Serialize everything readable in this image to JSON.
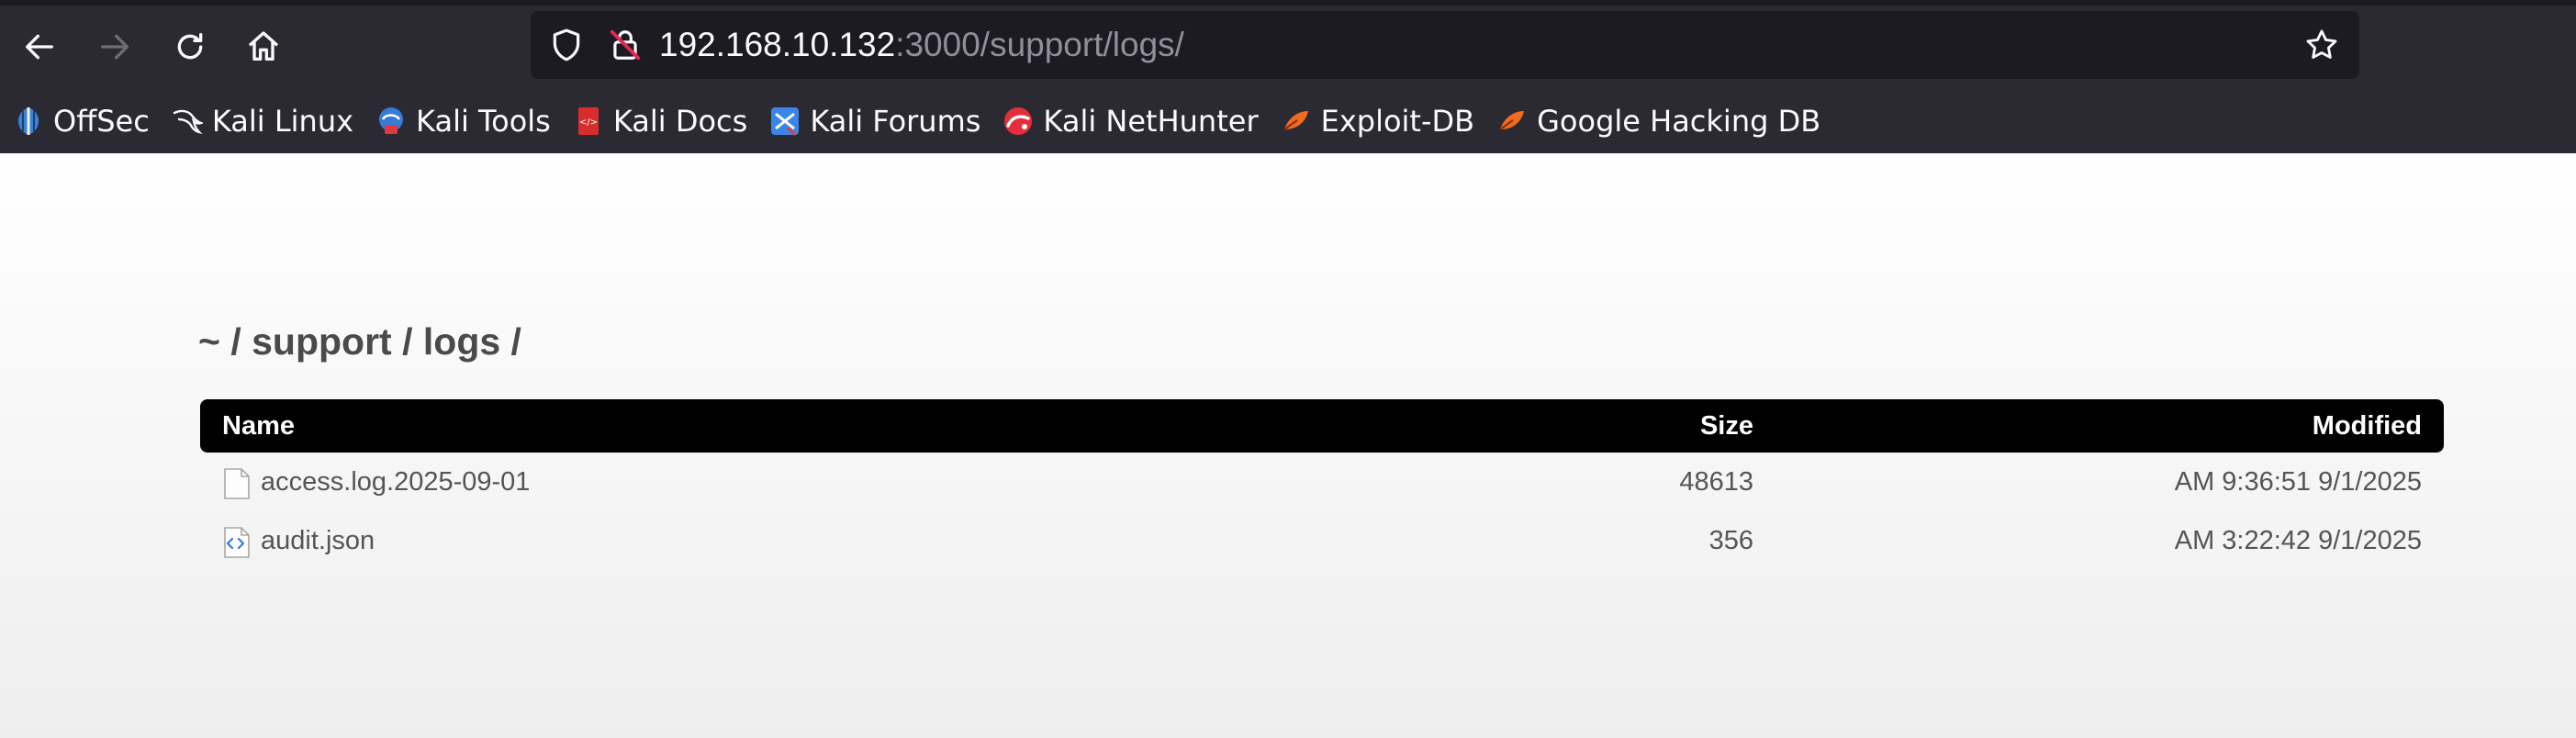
{
  "browser": {
    "url_host": "192.168.10.132",
    "url_rest": ":3000/support/logs/",
    "bookmarks": [
      {
        "label": "OffSec",
        "icon": "offsec-icon"
      },
      {
        "label": "Kali Linux",
        "icon": "kali-dragon-icon"
      },
      {
        "label": "Kali Tools",
        "icon": "kali-tools-icon"
      },
      {
        "label": "Kali Docs",
        "icon": "kali-docs-icon"
      },
      {
        "label": "Kali Forums",
        "icon": "kali-forums-icon"
      },
      {
        "label": "Kali NetHunter",
        "icon": "kali-nethunter-icon"
      },
      {
        "label": "Exploit-DB",
        "icon": "exploit-db-icon"
      },
      {
        "label": "Google Hacking DB",
        "icon": "ghdb-icon"
      }
    ]
  },
  "listing": {
    "breadcrumb": "~ / support / logs /",
    "columns": {
      "name": "Name",
      "size": "Size",
      "modified": "Modified"
    },
    "rows": [
      {
        "name": "access.log.2025-09-01",
        "size": "48613",
        "modified": "AM 9:36:51 9/1/2025",
        "icon": "file-icon"
      },
      {
        "name": "audit.json",
        "size": "356",
        "modified": "AM 3:22:42 9/1/2025",
        "icon": "code-file-icon"
      }
    ]
  },
  "colors": {
    "chrome_bg": "#2b2a33",
    "urlbar_bg": "#1c1b22",
    "table_header_bg": "#000000",
    "text_muted": "#555555"
  }
}
